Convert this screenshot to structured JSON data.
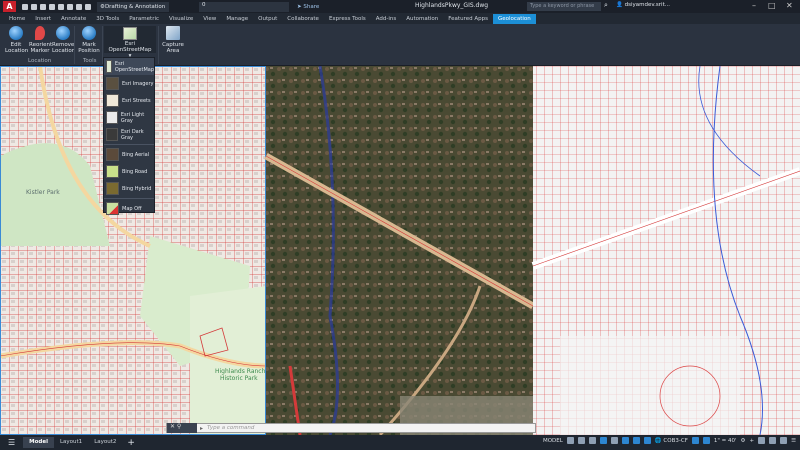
{
  "titlebar": {
    "app_logo": "A",
    "workspace": "Drafting & Annotation",
    "layer": "0",
    "share": "Share",
    "document_title": "HighlandsPkwy_GIS.dwg",
    "search_placeholder": "Type a keyword or phrase",
    "user": "dsiyamdev.srit..."
  },
  "tabs": [
    "Home",
    "Insert",
    "Annotate",
    "3D Tools",
    "Parametric",
    "Visualize",
    "View",
    "Manage",
    "Output",
    "Collaborate",
    "Express Tools",
    "Add-ins",
    "Automation",
    "Featured Apps",
    "Geolocation"
  ],
  "active_tab": "Geolocation",
  "ribbon": {
    "location": {
      "label": "Location",
      "buttons": [
        "Edit Location",
        "Reorient Marker",
        "Remove Location"
      ]
    },
    "tools": {
      "label": "Tools",
      "buttons": [
        "Mark Position"
      ]
    },
    "map_selector": "Esri OpenStreetMap",
    "capture": "Capture Area"
  },
  "map_menu": {
    "items": [
      "Esri OpenStreetMap",
      "Esri Imagery",
      "Esri Streets",
      "Esri Light Gray",
      "Esri Dark Gray",
      "Bing Aerial",
      "Bing Road",
      "Bing Hybrid",
      "Map Off"
    ],
    "selected": "Esri OpenStreetMap"
  },
  "map_labels": {
    "park1": "Kistler Park",
    "park2a": "Highlands Ranch",
    "park2b": "Historic Park"
  },
  "command_line": {
    "placeholder": "Type a command"
  },
  "layout_tabs": [
    "Model",
    "Layout1",
    "Layout2"
  ],
  "active_layout": "Model",
  "statusbar": {
    "model": "MODEL",
    "coords": "COB3-CF",
    "scale": "1\" = 40'"
  },
  "colors": {
    "accent": "#1c8fd6",
    "parcel": "#d43a3a",
    "satellite": "#3c4a2c",
    "osm_bg": "#f1ede4"
  }
}
